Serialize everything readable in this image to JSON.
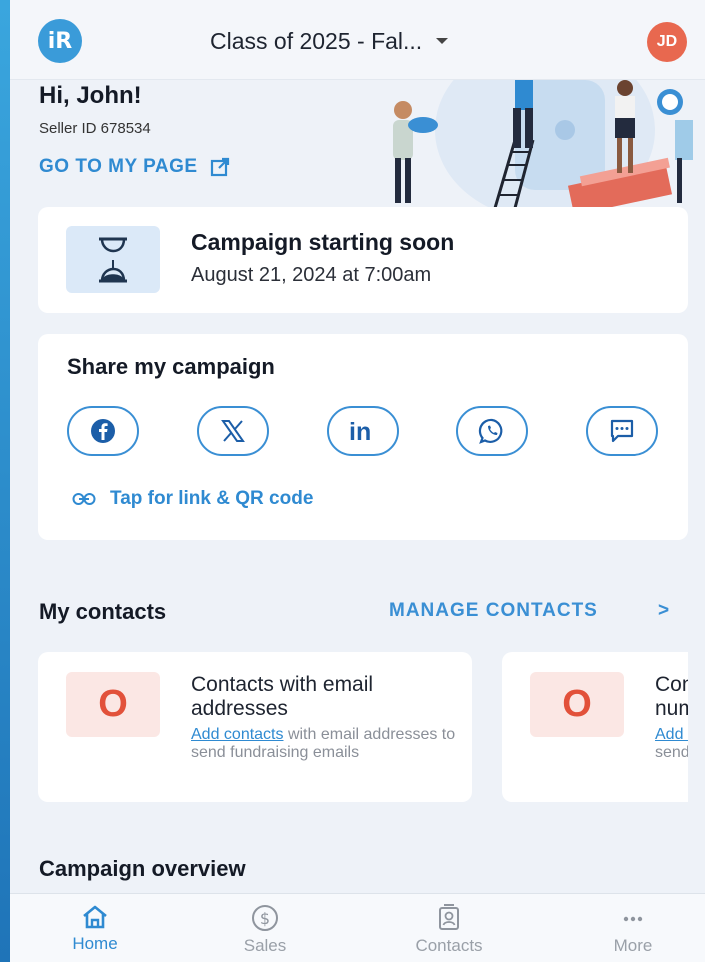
{
  "header": {
    "class_title": "Class of 2025 - Fal...",
    "avatar_initials": "JD",
    "logo_text": "iR"
  },
  "hero": {
    "greeting": "Hi, John!",
    "seller_id": "Seller ID 678534",
    "go_to_page": "GO TO MY PAGE"
  },
  "campaign": {
    "title": "Campaign starting soon",
    "date": "August 21, 2024 at 7:00am"
  },
  "share": {
    "title": "Share my campaign",
    "icons": [
      "facebook-icon",
      "x-icon",
      "linkedin-icon",
      "whatsapp-icon",
      "sms-icon"
    ],
    "link_label": "Tap for link & QR code"
  },
  "contacts": {
    "title": "My contacts",
    "manage_label": "MANAGE CONTACTS",
    "chevron": ">",
    "cards": [
      {
        "count": "O",
        "title": "Contacts with email addresses",
        "link": "Add contacts",
        "desc": " with email addresses to send fundraising emails"
      },
      {
        "count": "O",
        "title": "Contacts with phone numbers",
        "link": "Add contacts",
        "desc": " with phone numbers to send fundraising texts"
      }
    ]
  },
  "overview": {
    "title": "Campaign overview"
  },
  "nav": {
    "items": [
      {
        "label": "Home",
        "icon": "home-icon",
        "active": true
      },
      {
        "label": "Sales",
        "icon": "dollar-icon",
        "active": false
      },
      {
        "label": "Contacts",
        "icon": "contacts-icon",
        "active": false
      },
      {
        "label": "More",
        "icon": "more-icon",
        "active": false
      }
    ]
  },
  "colors": {
    "accent": "#2f8ad1",
    "avatar": "#e8684f",
    "count": "#e2513a"
  }
}
